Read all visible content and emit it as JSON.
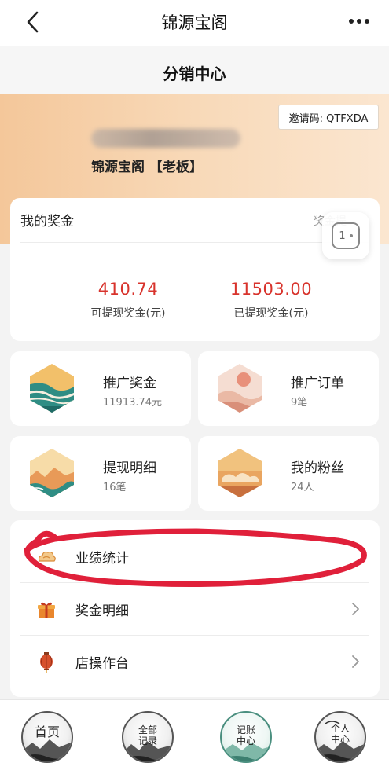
{
  "header": {
    "title": "锦源宝阁"
  },
  "subheader": {
    "title": "分销中心"
  },
  "profile": {
    "invite_code": "邀请码: QTFXDA",
    "store_name": "锦源宝阁 【老板】"
  },
  "bonus": {
    "title": "我的奖金",
    "link_label": "奖金提",
    "withdrawable_amount": "410.74",
    "withdrawable_label": "可提现奖金(元)",
    "withdrawn_amount": "11503.00",
    "withdrawn_label": "已提现奖金(元)"
  },
  "floating_button": {
    "label": "1"
  },
  "tiles": [
    {
      "name": "推广奖金",
      "value": "11913.74元"
    },
    {
      "name": "推广订单",
      "value": "9笔"
    },
    {
      "name": "提现明细",
      "value": "16笔"
    },
    {
      "name": "我的粉丝",
      "value": "24人"
    }
  ],
  "menu": [
    {
      "label": "业绩统计",
      "icon": "chart-icon"
    },
    {
      "label": "奖金明细",
      "icon": "gift-icon"
    },
    {
      "label": "店操作台",
      "icon": "lantern-icon"
    }
  ],
  "tabbar": [
    {
      "line1": "首页",
      "line2": ""
    },
    {
      "line1": "全部",
      "line2": "记录"
    },
    {
      "line1": "记账",
      "line2": "中心"
    },
    {
      "line1": "个人",
      "line2": "中心"
    }
  ],
  "colors": {
    "accent_red": "#d8332c",
    "annotation_red": "#e0203a",
    "header_peach": "#f4c79a"
  }
}
